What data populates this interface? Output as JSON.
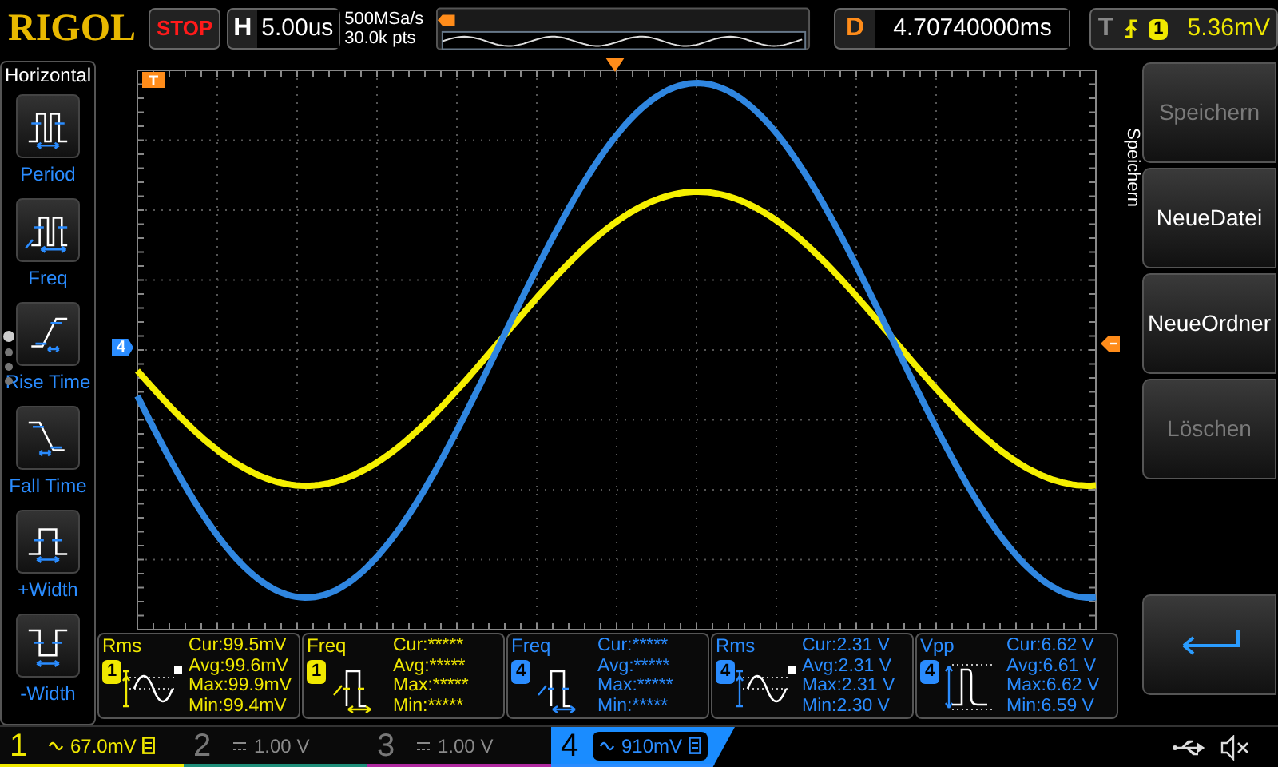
{
  "header": {
    "logo": "RIGOL",
    "run_state": "STOP",
    "timebase": {
      "label": "H",
      "value": "5.00us"
    },
    "sample_rate": "500MSa/s",
    "memory_depth": "30.0k pts",
    "delay": {
      "label": "D",
      "value": "4.70740000ms"
    },
    "trigger": {
      "label": "T",
      "source": "1",
      "level": "5.36mV"
    }
  },
  "left_menu": {
    "title": "Horizontal",
    "items": [
      {
        "label": "Period",
        "kind": "period"
      },
      {
        "label": "Freq",
        "kind": "freq"
      },
      {
        "label": "Rise Time",
        "kind": "rise"
      },
      {
        "label": "Fall Time",
        "kind": "fall"
      },
      {
        "label": "+Width",
        "kind": "pwidth"
      },
      {
        "label": "-Width",
        "kind": "nwidth"
      }
    ],
    "page_dots": [
      {
        "selected": true
      },
      {
        "selected": false
      },
      {
        "selected": false
      },
      {
        "selected": false
      }
    ]
  },
  "plot": {
    "channel_marker": "4"
  },
  "measurements": [
    {
      "name": "Rms",
      "channel": "1",
      "kind": "rms",
      "color": "#f0e800",
      "lines": [
        "Cur:99.5mV",
        "Avg:99.6mV",
        "Max:99.9mV",
        "Min:99.4mV"
      ]
    },
    {
      "name": "Freq",
      "channel": "1",
      "kind": "freq",
      "color": "#f0e800",
      "lines": [
        "Cur:*****",
        "Avg:*****",
        "Max:*****",
        "Min:*****"
      ]
    },
    {
      "name": "Freq",
      "channel": "4",
      "kind": "freq",
      "color": "#2a8cff",
      "lines": [
        "Cur:*****",
        "Avg:*****",
        "Max:*****",
        "Min:*****"
      ]
    },
    {
      "name": "Rms",
      "channel": "4",
      "kind": "rms",
      "color": "#2a8cff",
      "lines": [
        "Cur:2.31 V",
        "Avg:2.31 V",
        "Max:2.31 V",
        "Min:2.30 V"
      ]
    },
    {
      "name": "Vpp",
      "channel": "4",
      "kind": "vpp",
      "color": "#2a8cff",
      "lines": [
        "Cur:6.62 V",
        "Avg:6.61 V",
        "Max:6.62 V",
        "Min:6.59 V"
      ]
    }
  ],
  "right_menu": {
    "title": "Speichern",
    "buttons": [
      {
        "label": "Speichern",
        "disabled": true
      },
      {
        "label": "NeueDatei",
        "disabled": false
      },
      {
        "label": "NeueOrdner",
        "disabled": false
      },
      {
        "label": "Löschen",
        "disabled": true
      }
    ]
  },
  "channels": [
    {
      "number": "1",
      "kind": "ac",
      "scale": "67.0mV",
      "on": true,
      "selected": false,
      "color": "#f0e800"
    },
    {
      "number": "2",
      "kind": "dc",
      "scale": "1.00 V",
      "on": false,
      "selected": false,
      "color": "#1f8f7a"
    },
    {
      "number": "3",
      "kind": "dc",
      "scale": "1.00 V",
      "on": false,
      "selected": false,
      "color": "#b02aa0"
    },
    {
      "number": "4",
      "kind": "ac",
      "scale": "910mV",
      "on": true,
      "selected": true,
      "color": "#2a8cff"
    }
  ]
}
